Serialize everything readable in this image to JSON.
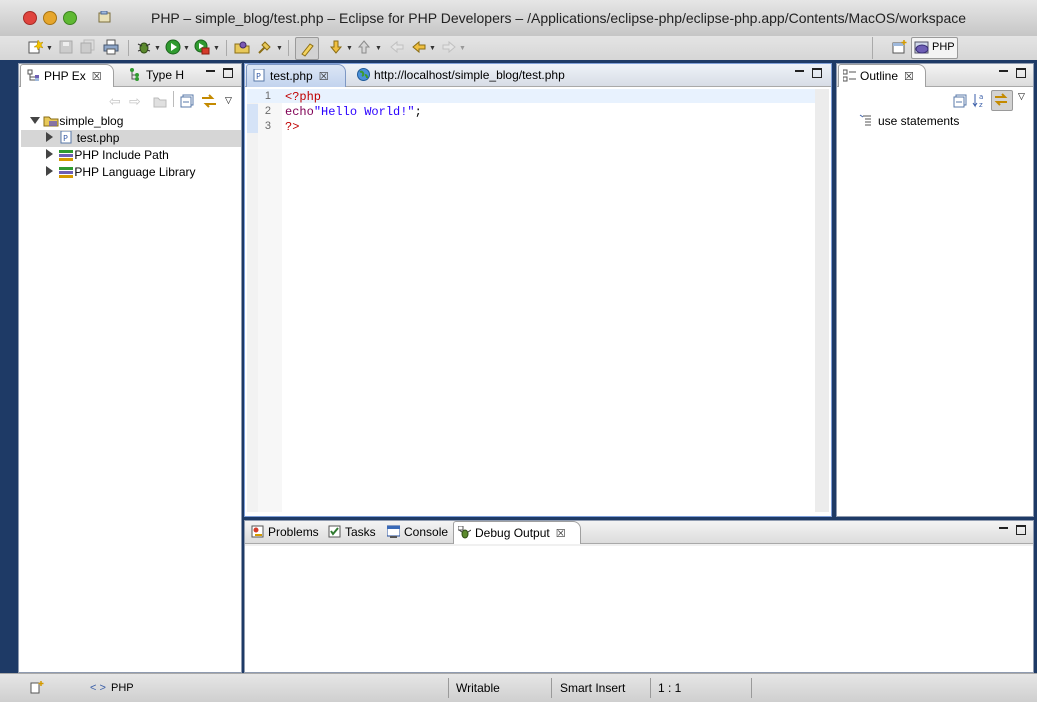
{
  "window": {
    "title": "PHP – simple_blog/test.php – Eclipse for PHP Developers – /Applications/eclipse-php/eclipse-php.app/Contents/MacOS/workspace"
  },
  "toolbar": {
    "perspective_label": "PHP"
  },
  "left_panel": {
    "tabs": [
      {
        "label": "PHP Ex",
        "active": true
      },
      {
        "label": "Type H",
        "active": false
      }
    ],
    "tree": {
      "root": "simple_blog",
      "items": [
        {
          "label": "test.php",
          "icon": "php-file-icon",
          "selected": true
        },
        {
          "label": "PHP Include Path",
          "icon": "library-icon"
        },
        {
          "label": "PHP Language Library",
          "icon": "library-icon"
        }
      ]
    }
  },
  "editor": {
    "tabs": [
      {
        "label": "test.php",
        "active": true
      },
      {
        "label": "http://localhost/simple_blog/test.php",
        "active": false
      }
    ],
    "lines": [
      {
        "num": "1",
        "parts": [
          {
            "text": "<?php",
            "color": "#c00000"
          }
        ]
      },
      {
        "num": "2",
        "parts": [
          {
            "text": "echo",
            "color": "#7f0055"
          },
          {
            "text": "\"Hello World!\"",
            "color": "#2a00ff"
          },
          {
            "text": ";",
            "color": "#000000"
          }
        ]
      },
      {
        "num": "3",
        "parts": [
          {
            "text": "?>",
            "color": "#c00000"
          }
        ]
      }
    ]
  },
  "outline": {
    "tab_label": "Outline",
    "items": [
      {
        "label": "use statements"
      }
    ]
  },
  "bottom_panel": {
    "tabs": [
      {
        "label": "Problems",
        "icon": "problems-icon"
      },
      {
        "label": "Tasks",
        "icon": "tasks-icon"
      },
      {
        "label": "Console",
        "icon": "console-icon"
      },
      {
        "label": "Debug Output",
        "icon": "debug-output-icon",
        "active": true
      }
    ]
  },
  "statusbar": {
    "content_type": "PHP",
    "content_type_glyph": "< >",
    "mode": "Writable",
    "insert_mode": "Smart Insert",
    "position": "1 : 1"
  },
  "colors": {
    "selection": "#d6d6d6",
    "editor_active_border": "#7f9fd8",
    "current_line": "#e8f2fe"
  }
}
